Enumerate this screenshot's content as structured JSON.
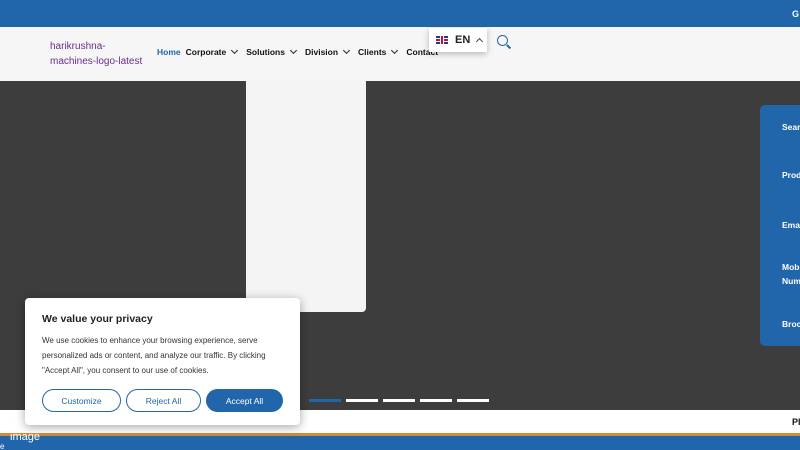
{
  "topbar": {
    "text": "G"
  },
  "header": {
    "logo_alt": "harikrushna-machines-logo-latest",
    "nav": [
      {
        "label": "Home",
        "active": true,
        "has_dropdown": false
      },
      {
        "label": "Corporate",
        "active": false,
        "has_dropdown": true
      },
      {
        "label": "Solutions",
        "active": false,
        "has_dropdown": true
      },
      {
        "label": "Division",
        "active": false,
        "has_dropdown": true
      },
      {
        "label": "Clients",
        "active": false,
        "has_dropdown": true
      },
      {
        "label": "Contact",
        "active": false,
        "has_dropdown": false
      }
    ],
    "language": {
      "label": "EN",
      "flag": "uk-flag-icon"
    },
    "search_icon": "search-icon"
  },
  "side_form": {
    "labels": [
      "Sear",
      "Prod",
      "Ema",
      "Mob",
      "Num",
      "Broc"
    ]
  },
  "slider": {
    "slide_count": 5,
    "active_index": 0
  },
  "strip": {
    "text": "Pl"
  },
  "footer": {
    "image_alt": "image",
    "glyph": "e"
  },
  "cookie": {
    "title": "We value your privacy",
    "body": "We use cookies to enhance your browsing experience, serve personalized ads or content, and analyze our traffic. By clicking \"Accept All\", you consent to our use of cookies.",
    "buttons": {
      "customize": "Customize",
      "reject": "Reject All",
      "accept": "Accept All"
    }
  },
  "colors": {
    "primary": "#2166ab",
    "hero_bg": "#3d3d3d",
    "logo_text": "#6a2d8f",
    "accent_line": "#d38a3a"
  }
}
